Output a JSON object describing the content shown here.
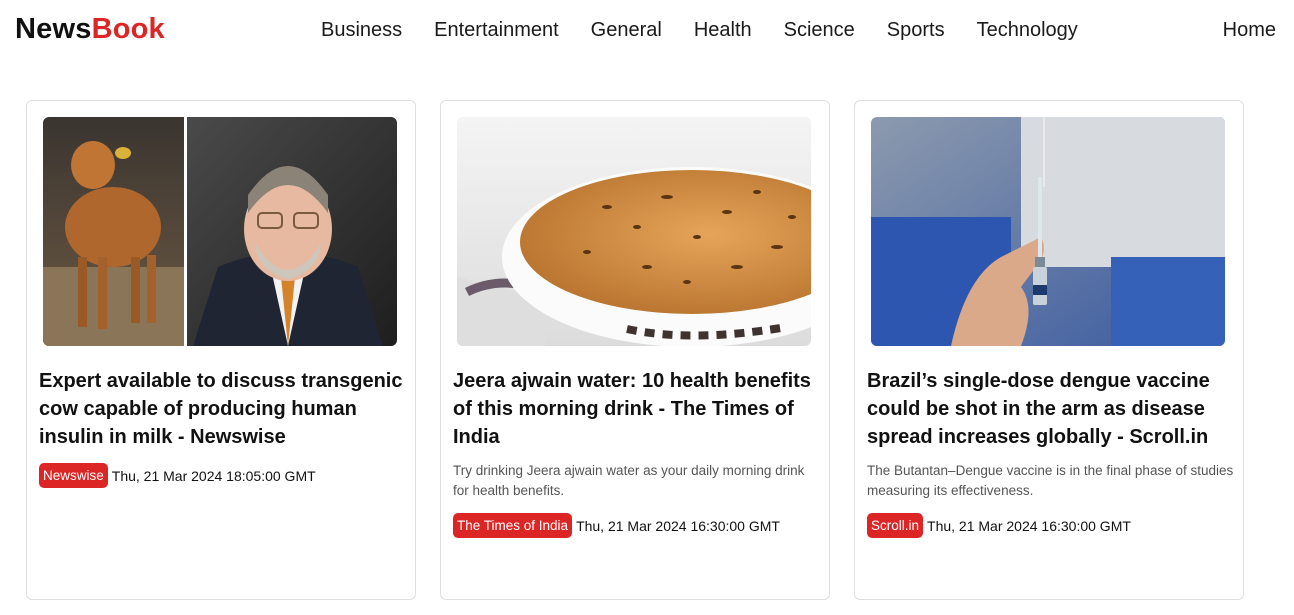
{
  "brand": {
    "part1": "News",
    "part2": "Book"
  },
  "nav": {
    "categories": [
      "Business",
      "Entertainment",
      "General",
      "Health",
      "Science",
      "Sports",
      "Technology"
    ],
    "home": "Home"
  },
  "colors": {
    "accent": "#dc2626"
  },
  "articles": [
    {
      "title": "Expert available to discuss transgenic cow capable of producing human insulin in milk - Newswise",
      "description": "",
      "source": "Newswise",
      "date": "Thu, 21 Mar 2024 18:05:00 GMT",
      "image": "cow-and-scientist-photo"
    },
    {
      "title": "Jeera ajwain water: 10 health benefits of this morning drink - The Times of India",
      "description": "Try drinking Jeera ajwain water as your daily morning drink for health benefits.",
      "source": "The Times of India",
      "date": "Thu, 21 Mar 2024 16:30:00 GMT",
      "image": "cup-of-jeera-water-photo"
    },
    {
      "title": "Brazil’s single-dose dengue vaccine could be shot in the arm as disease spread increases globally - Scroll.in",
      "description": "The Butantan–Dengue vaccine is in the final phase of studies measuring its effectiveness.",
      "source": "Scroll.in",
      "date": "Thu, 21 Mar 2024 16:30:00 GMT",
      "image": "vaccine-syringe-photo"
    }
  ]
}
